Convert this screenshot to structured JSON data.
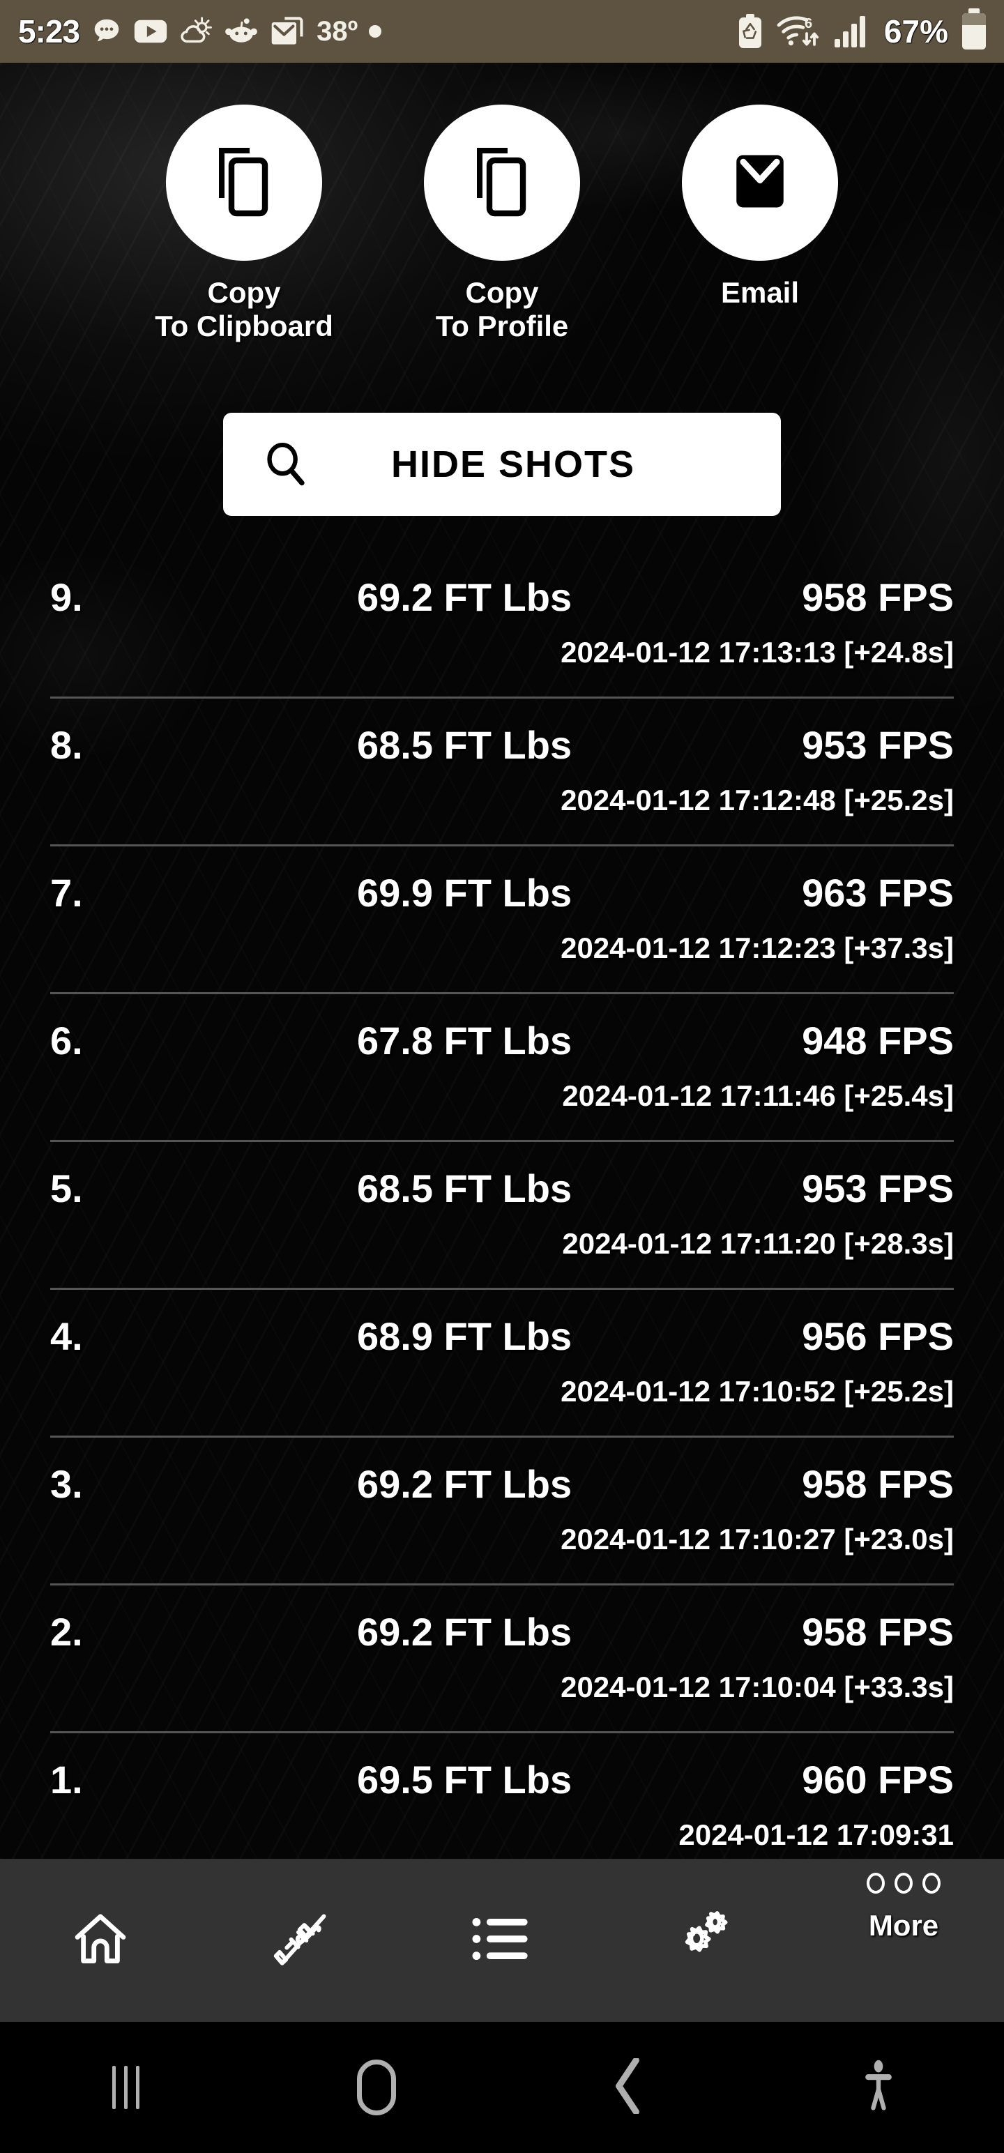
{
  "status_bar": {
    "time": "5:23",
    "temperature": "38º",
    "battery_percent": "67%",
    "left_icons": [
      "chat-bubble-icon",
      "youtube-icon",
      "weather-icon",
      "reddit-icon",
      "gmail-icon"
    ],
    "right_icons": [
      "battery-saver-icon",
      "wifi-6-icon",
      "cellular-signal-icon",
      "battery-icon"
    ],
    "background_color": "#5d5340"
  },
  "actions": [
    {
      "label": "Copy\nTo Clipboard",
      "icon": "copy-icon",
      "name": "copy-to-clipboard"
    },
    {
      "label": "Copy\nTo Profile",
      "icon": "copy-icon",
      "name": "copy-to-profile"
    },
    {
      "label": "Email",
      "icon": "envelope-icon",
      "name": "email"
    }
  ],
  "hide_shots_button": {
    "label": "HIDE SHOTS",
    "icon": "search-icon"
  },
  "units": {
    "energy": "FT Lbs",
    "speed": "FPS"
  },
  "shots": [
    {
      "index": "9.",
      "energy": "69.2 FT Lbs",
      "speed": "958 FPS",
      "timestamp": "2024-01-12 17:13:13 [+24.8s]"
    },
    {
      "index": "8.",
      "energy": "68.5 FT Lbs",
      "speed": "953 FPS",
      "timestamp": "2024-01-12 17:12:48 [+25.2s]"
    },
    {
      "index": "7.",
      "energy": "69.9 FT Lbs",
      "speed": "963 FPS",
      "timestamp": "2024-01-12 17:12:23 [+37.3s]"
    },
    {
      "index": "6.",
      "energy": "67.8 FT Lbs",
      "speed": "948 FPS",
      "timestamp": "2024-01-12 17:11:46 [+25.4s]"
    },
    {
      "index": "5.",
      "energy": "68.5 FT Lbs",
      "speed": "953 FPS",
      "timestamp": "2024-01-12 17:11:20 [+28.3s]"
    },
    {
      "index": "4.",
      "energy": "68.9 FT Lbs",
      "speed": "956 FPS",
      "timestamp": "2024-01-12 17:10:52 [+25.2s]"
    },
    {
      "index": "3.",
      "energy": "69.2 FT Lbs",
      "speed": "958 FPS",
      "timestamp": "2024-01-12 17:10:27 [+23.0s]"
    },
    {
      "index": "2.",
      "energy": "69.2 FT Lbs",
      "speed": "958 FPS",
      "timestamp": "2024-01-12 17:10:04 [+33.3s]"
    },
    {
      "index": "1.",
      "energy": "69.5 FT Lbs",
      "speed": "960 FPS",
      "timestamp": "2024-01-12 17:09:31"
    }
  ],
  "app_nav": [
    {
      "name": "nav-home",
      "icon": "home-icon",
      "label": ""
    },
    {
      "name": "nav-rifle",
      "icon": "rifle-scope-icon",
      "label": ""
    },
    {
      "name": "nav-list",
      "icon": "list-icon",
      "label": ""
    },
    {
      "name": "nav-settings",
      "icon": "gears-icon",
      "label": ""
    },
    {
      "name": "nav-more",
      "icon": "more-dots-icon",
      "label": "More"
    }
  ],
  "system_nav": [
    {
      "name": "sys-recents",
      "icon": "recents-icon"
    },
    {
      "name": "sys-home",
      "icon": "home-pill-icon"
    },
    {
      "name": "sys-back",
      "icon": "back-chevron-icon"
    },
    {
      "name": "sys-accessibility",
      "icon": "accessibility-icon"
    }
  ],
  "colors": {
    "status_bar_bg": "#5d5340",
    "app_nav_bg": "#333333",
    "system_nav_bg": "#000000",
    "accent_white": "#ffffff",
    "divider": "#555555"
  }
}
